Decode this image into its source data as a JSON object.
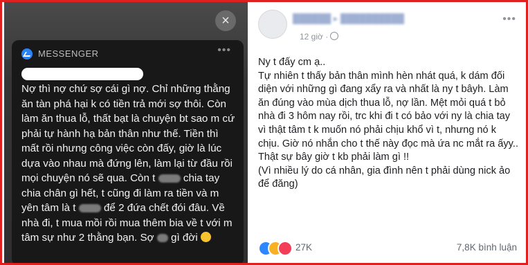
{
  "notification": {
    "app_name": "MESSENGER",
    "close_glyph": "×",
    "more_glyph": "•••",
    "message": [
      "Nợ thì nợ chứ sợ cái gì nợ. Chỉ những thằng ăn tàn phá hại k có tiền trả mới sợ thôi. Còn làm ăn thua lỗ, thất bạt là chuyện bt sao m cứ phải tự hành hạ bản thân như thế. Tiền thì mất rồi nhưng công việc còn đấy, giờ là lúc dựa vào nhau mà đứng lên, làm lại từ đầu rồi mọi chuyện nó sẽ qua.",
      "Còn t",
      "chia tay chia chân gì hết, t cũng đi làm ra tiền và m yên tâm là t",
      "để 2 đứa chết đói đâu. Về nhà đi, t mua mồi rồi mua thêm bia về t với m tâm sự như 2 thằng bạn. Sợ",
      "gì đời"
    ]
  },
  "post": {
    "time": "12 giờ ·",
    "more_glyph": "•••",
    "lines": [
      "Ny t đấy cm ạ..",
      "Tự nhiên t thấy bản thân mình hèn nhát quá, k dám đối diện với những gì đang xẩy ra và nhất là ny t bâyh. Làm ăn đúng vào mùa dịch thua lỗ, nợ lần. Mệt mỏi quá t bỏ nhà đi 3 hôm nay rồi, trc khi đi t có bảo với ny là chia tay vì thật tâm t k muốn nó phải chịu khổ vì t, nhưng nó k chịu. Giờ nó nhắn cho t thế này đọc mà ứa nc mắt ra ấyy.. Thật sự bây giờ t kb phải làm gì !!",
      "(Vì nhiều lý do cá nhân, gia đình nên t phải dùng nick ảo để đăng)"
    ],
    "reactions": {
      "count": "27K",
      "comments": "7,8K bình luận",
      "icons": [
        "like-icon",
        "haha-icon",
        "love-icon"
      ]
    }
  },
  "colors": {
    "frame_border": "#e01f1f",
    "messenger_blue": "#2b83f6",
    "like_blue": "#2d88ff",
    "love_red": "#f33e58",
    "haha_yellow": "#f7b125"
  }
}
